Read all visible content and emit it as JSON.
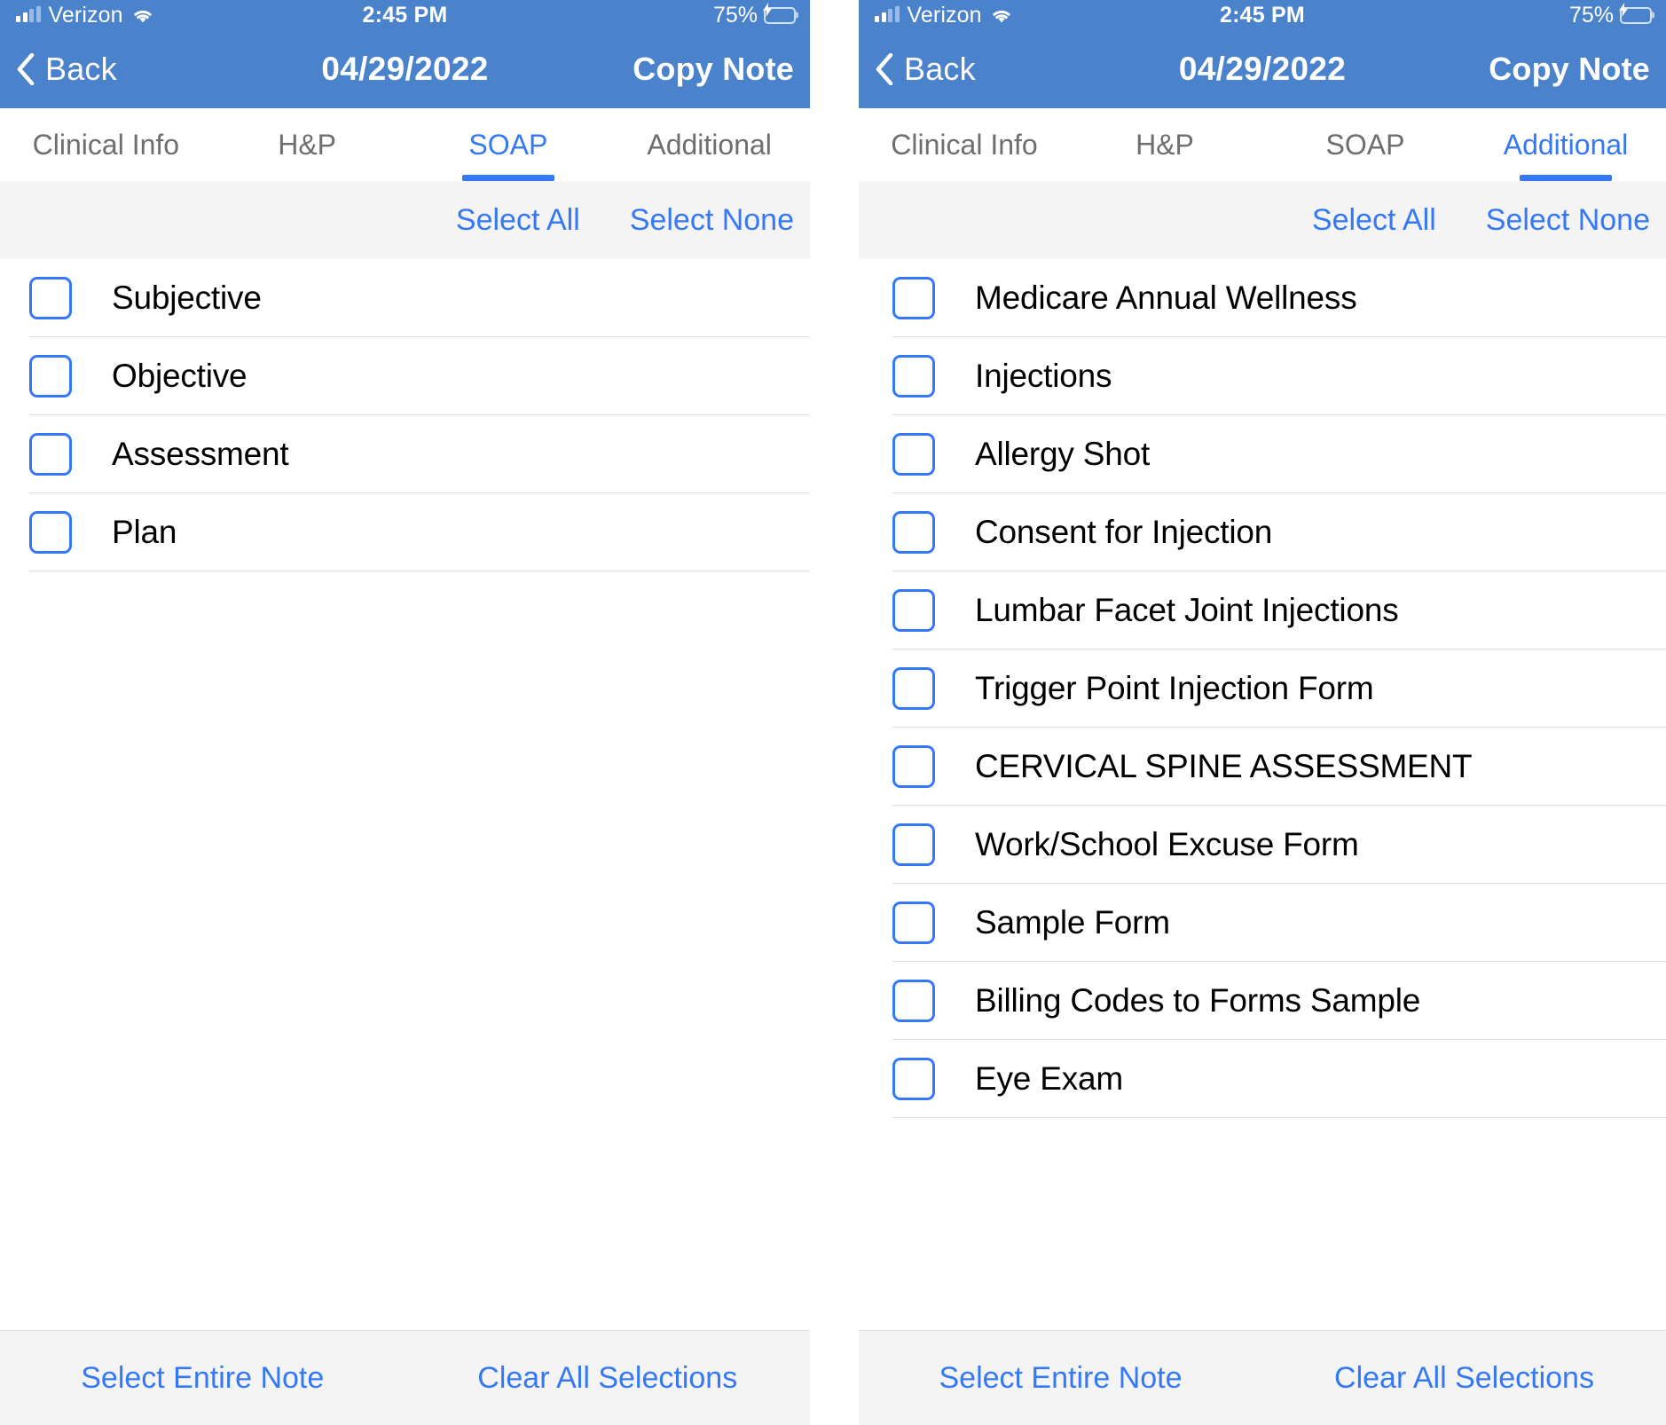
{
  "screens": [
    {
      "status_bar": {
        "signal_icon": "signal-bars-icon",
        "carrier": "Verizon",
        "wifi_icon": "wifi-icon",
        "time": "2:45 PM",
        "battery_percent": "75%",
        "battery_icon": "battery-charging-icon"
      },
      "nav_bar": {
        "back_icon": "chevron-left-icon",
        "back_label": "Back",
        "title": "04/29/2022",
        "action_label": "Copy Note"
      },
      "tabs": [
        {
          "label": "Clinical Info",
          "active": false
        },
        {
          "label": "H&P",
          "active": false
        },
        {
          "label": "SOAP",
          "active": true
        },
        {
          "label": "Additional",
          "active": false
        }
      ],
      "select_bar": {
        "select_all": "Select All",
        "select_none": "Select None"
      },
      "items": [
        {
          "label": "Subjective",
          "checked": false
        },
        {
          "label": "Objective",
          "checked": false
        },
        {
          "label": "Assessment",
          "checked": false
        },
        {
          "label": "Plan",
          "checked": false
        }
      ],
      "bottom_bar": {
        "select_entire_note": "Select Entire Note",
        "clear_all_selections": "Clear All Selections"
      }
    },
    {
      "status_bar": {
        "signal_icon": "signal-bars-icon",
        "carrier": "Verizon",
        "wifi_icon": "wifi-icon",
        "time": "2:45 PM",
        "battery_percent": "75%",
        "battery_icon": "battery-charging-icon"
      },
      "nav_bar": {
        "back_icon": "chevron-left-icon",
        "back_label": "Back",
        "title": "04/29/2022",
        "action_label": "Copy Note"
      },
      "tabs": [
        {
          "label": "Clinical Info",
          "active": false
        },
        {
          "label": "H&P",
          "active": false
        },
        {
          "label": "SOAP",
          "active": false
        },
        {
          "label": "Additional",
          "active": true
        }
      ],
      "select_bar": {
        "select_all": "Select All",
        "select_none": "Select None"
      },
      "items": [
        {
          "label": "Medicare Annual Wellness",
          "checked": false
        },
        {
          "label": "Injections",
          "checked": false
        },
        {
          "label": "Allergy Shot",
          "checked": false
        },
        {
          "label": "Consent for Injection",
          "checked": false
        },
        {
          "label": "Lumbar Facet Joint Injections",
          "checked": false
        },
        {
          "label": "Trigger Point Injection Form",
          "checked": false
        },
        {
          "label": "CERVICAL SPINE ASSESSMENT",
          "checked": false
        },
        {
          "label": "Work/School Excuse Form",
          "checked": false
        },
        {
          "label": "Sample Form",
          "checked": false
        },
        {
          "label": "Billing Codes to Forms Sample",
          "checked": false
        },
        {
          "label": "Eye Exam",
          "checked": false
        }
      ],
      "bottom_bar": {
        "select_entire_note": "Select Entire Note",
        "clear_all_selections": "Clear All Selections"
      }
    }
  ],
  "colors": {
    "header_blue": "#4a82cc",
    "accent_blue": "#3478f6",
    "bar_gray": "#f4f4f4",
    "divider": "#dcdcdc",
    "battery_green": "#4cd55c",
    "tab_inactive": "#6e6e6e"
  }
}
